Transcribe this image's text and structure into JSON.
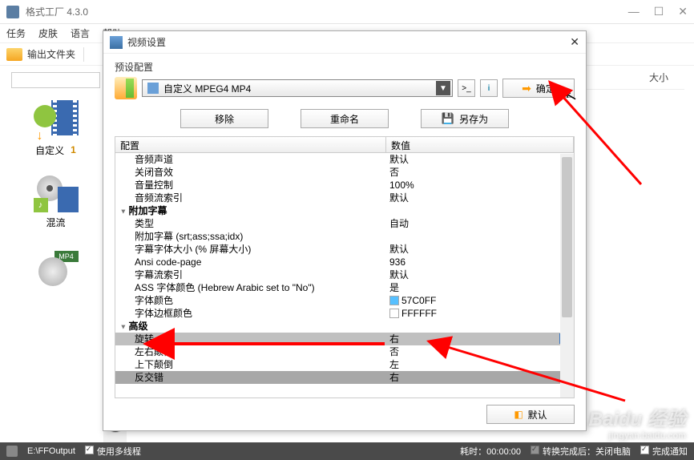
{
  "titlebar": {
    "title": "格式工厂 4.3.0"
  },
  "menubar": {
    "items": [
      "任务",
      "皮肤",
      "语言",
      "帮助"
    ]
  },
  "toolbar": {
    "outputFolder": "输出文件夹"
  },
  "rightpane": {
    "sizeHeader": "大小"
  },
  "sidebar": {
    "customLabel": "自定义",
    "customBadge": "1",
    "mixLabel": "混流",
    "mp4Tag": "MP4"
  },
  "tabstrip": {
    "musicGlyph": "♪"
  },
  "statusbar": {
    "outputPath": "E:\\FFOutput",
    "multithread": "使用多线程",
    "elapsed": "耗时：00:00:00",
    "afterConvert": "转换完成后：关闭电脑",
    "notify": "完成通知"
  },
  "dialog": {
    "title": "视频设置",
    "presetLabel": "预设配置",
    "presetValue": "自定义 MPEG4 MP4",
    "ok": "确定",
    "remove": "移除",
    "rename": "重命名",
    "saveAs": "另存为",
    "defaultBtn": "默认",
    "table": {
      "h1": "配置",
      "h2": "数值",
      "rows": [
        {
          "k": "音频声道",
          "v": "默认"
        },
        {
          "k": "关闭音效",
          "v": "否"
        },
        {
          "k": "音量控制",
          "v": "100%"
        },
        {
          "k": "音频流索引",
          "v": "默认"
        },
        {
          "k": "附加字幕",
          "v": "",
          "group": true
        },
        {
          "k": "类型",
          "v": "自动"
        },
        {
          "k": "附加字幕 (srt;ass;ssa;idx)",
          "v": ""
        },
        {
          "k": "字幕字体大小 (% 屏幕大小)",
          "v": "默认"
        },
        {
          "k": "Ansi code-page",
          "v": "936"
        },
        {
          "k": "字幕流索引",
          "v": "默认"
        },
        {
          "k": "ASS 字体颜色 (Hebrew Arabic set to \"No\")",
          "v": "是"
        },
        {
          "k": "字体颜色",
          "v": "57C0FF",
          "color": "#57C0FF"
        },
        {
          "k": "字体边框颜色",
          "v": "FFFFFF",
          "color": "#FFFFFF"
        },
        {
          "k": "高级",
          "v": "",
          "group": true
        },
        {
          "k": "旋转",
          "v": "右",
          "selected": true
        },
        {
          "k": "左右颠倒",
          "v": "否"
        },
        {
          "k": "上下颠倒",
          "v": "左"
        },
        {
          "k": "反交错",
          "v": "右",
          "dim": true
        }
      ]
    }
  },
  "watermark": {
    "main": "Baidu 经验",
    "sub": "jingyan.baidu.com"
  }
}
